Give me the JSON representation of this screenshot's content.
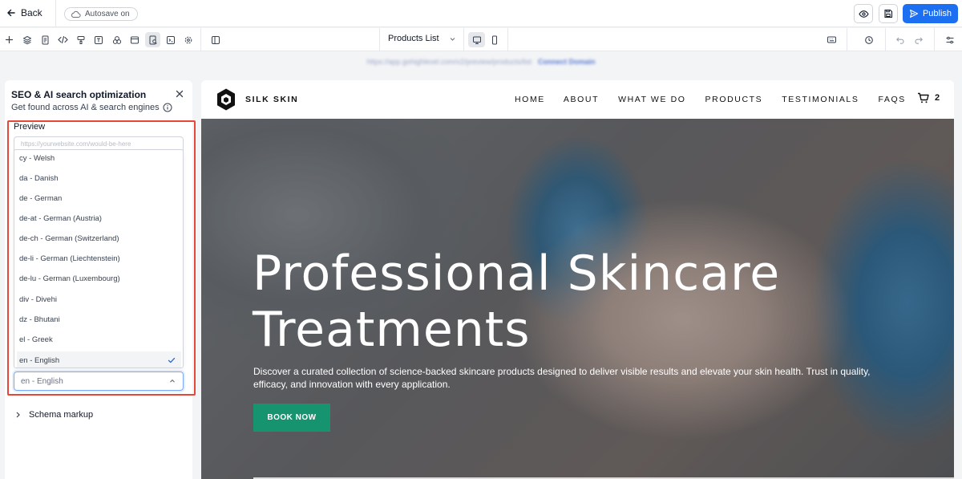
{
  "topbar": {
    "back_label": "Back",
    "autosave_label": "Autosave on",
    "publish_label": "Publish"
  },
  "toolbar": {
    "tools": [
      "add-icon",
      "layers-icon",
      "pages-icon",
      "code-icon",
      "paint-icon",
      "text-icon",
      "components-icon",
      "media-icon",
      "seo-icon",
      "terminal-icon",
      "settings-icon",
      "layout-icon"
    ],
    "page_select_label": "Products List"
  },
  "url_bar": {
    "url_text": "https://app.gohighlevel.com/v2/preview/products/list",
    "connect_label": "Connect Domain"
  },
  "seo_panel": {
    "title": "SEO & AI search optimization",
    "subtitle": "Get found across AI & search engines",
    "preview_label": "Preview",
    "url_placeholder": "https://yourwebsite.com/would-be-here",
    "language_options": [
      {
        "label": "cy - Welsh"
      },
      {
        "label": "da - Danish"
      },
      {
        "label": "de - German"
      },
      {
        "label": "de-at - German (Austria)"
      },
      {
        "label": "de-ch - German (Switzerland)"
      },
      {
        "label": "de-li - German (Liechtenstein)"
      },
      {
        "label": "de-lu - German (Luxembourg)"
      },
      {
        "label": "div - Divehi"
      },
      {
        "label": "dz - Bhutani"
      },
      {
        "label": "el - Greek"
      },
      {
        "label": "en - English"
      }
    ],
    "selected_language": "en - English",
    "schema_label": "Schema markup"
  },
  "site": {
    "brand": "SILK SKIN",
    "nav": [
      "HOME",
      "ABOUT",
      "WHAT WE DO",
      "PRODUCTS",
      "TESTIMONIALS",
      "FAQS"
    ],
    "cart_count": "2",
    "hero_title_line1": "Professional Skincare",
    "hero_title_line2": "Treatments",
    "hero_desc_line1": "Discover a curated collection of science-backed skincare products designed to deliver visible results and elevate your skin health. Trust in quality,",
    "hero_desc_line2": "efficacy, and innovation with every application.",
    "cta_label": "BOOK NOW"
  },
  "colors": {
    "publish": "#1d6ff2",
    "highlight_border": "#e5483b",
    "cta": "#16936f",
    "check": "#2563eb"
  }
}
